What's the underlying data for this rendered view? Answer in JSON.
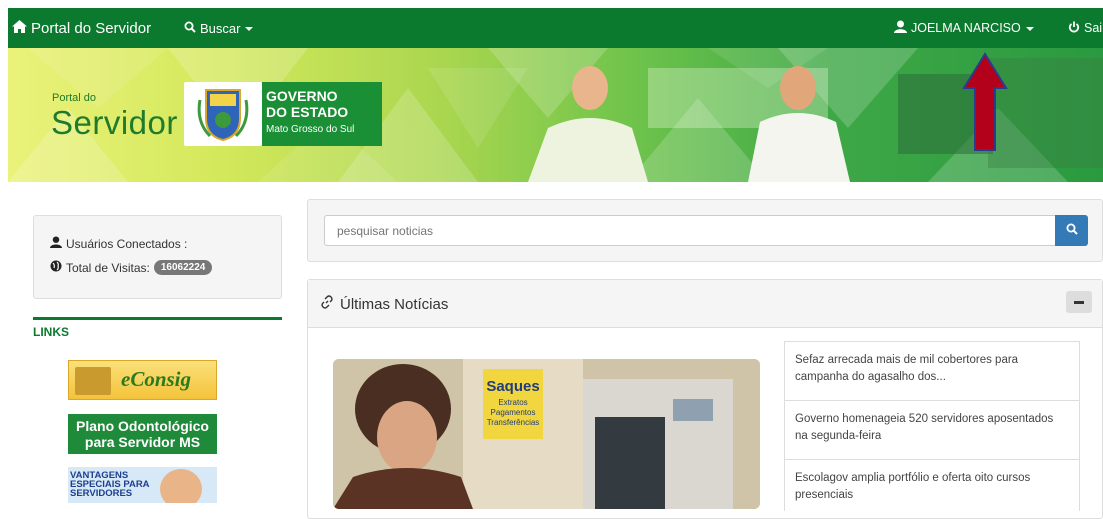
{
  "topnav": {
    "brand": "Portal do Servidor",
    "search": "Buscar",
    "user": "JOELMA NARCISO",
    "logout": "Sair"
  },
  "banner": {
    "portal_small": "Portal do",
    "portal_big": "Servidor",
    "gov_line1": "GOVERNO",
    "gov_line2": "DO ESTADO",
    "gov_line3": "Mato Grosso do Sul"
  },
  "sidebar": {
    "users_label": "Usuários Conectados :",
    "visits_label": "Total de Visitas:",
    "visits_count": "16062224",
    "links_title": "LINKS",
    "econsig_label": "eConsig",
    "odonto_line1": "Plano Odontológico",
    "odonto_line2": "para Servidor MS",
    "vantagens_label": "VANTAGENS ESPECIAIS PARA SERVIDORES"
  },
  "search": {
    "placeholder": "pesquisar noticias"
  },
  "news": {
    "title": "Últimas Notícias",
    "photo_sign_title": "Saques",
    "photo_sign_l1": "Extratos",
    "photo_sign_l2": "Pagamentos",
    "photo_sign_l3": "Transferências",
    "items": [
      "Sefaz arrecada mais de mil cobertores para campanha do agasalho dos...",
      "Governo homenageia 520 servidores aposentados na segunda-feira",
      "Escolagov amplia portfólio e oferta oito cursos presenciais"
    ]
  },
  "colors": {
    "nav_green": "#0b7a2f",
    "primary_blue": "#337ab7",
    "arrow_red": "#b3001b"
  }
}
